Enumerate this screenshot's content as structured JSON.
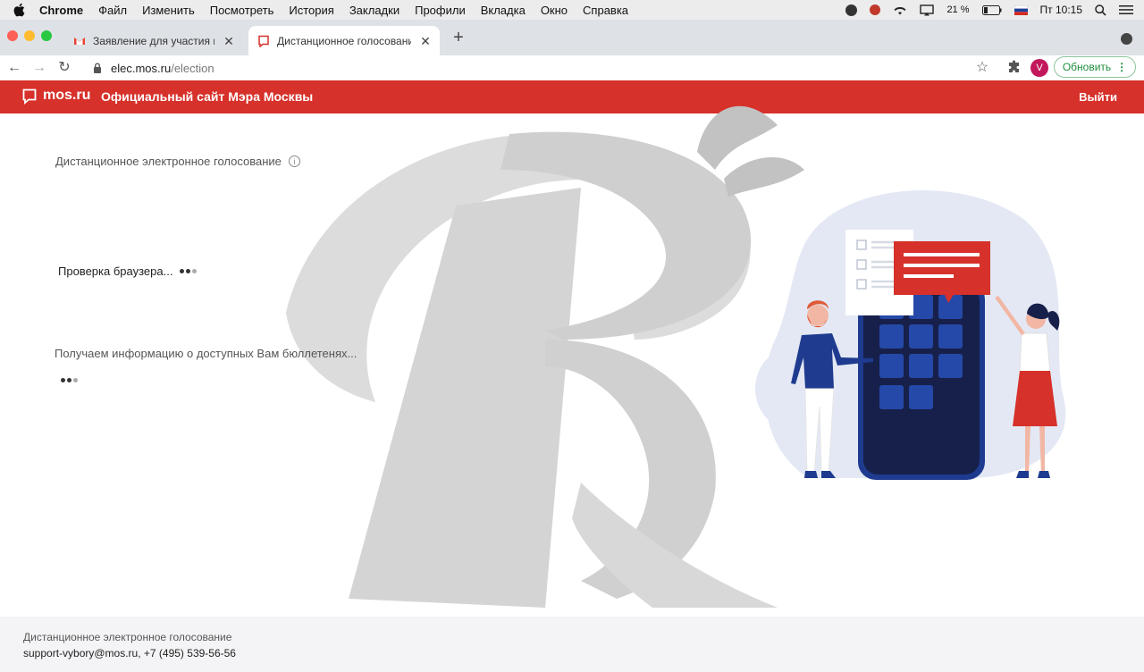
{
  "menubar": {
    "app": "Chrome",
    "items": [
      "Файл",
      "Изменить",
      "Посмотреть",
      "История",
      "Закладки",
      "Профили",
      "Вкладка",
      "Окно",
      "Справка"
    ],
    "battery": "21 %",
    "clock": "Пт 10:15"
  },
  "tabs": [
    {
      "title": "Заявление для участия в дис",
      "icon": "gmail-icon"
    },
    {
      "title": "Дистанционное голосование",
      "icon": "mos-icon"
    }
  ],
  "toolbar": {
    "url_host": "elec.mos.ru",
    "url_path": "/election",
    "profile_letter": "V",
    "update_label": "Обновить"
  },
  "site": {
    "logo": "mos.ru",
    "title": "Официальный сайт Мэра Москвы",
    "login": "Выйти",
    "brand_color": "#d6312a"
  },
  "main": {
    "heading": "Дистанционное электронное голосование",
    "status_browser": "Проверка браузера...",
    "status_ballots": "Получаем информацию о доступных Вам бюллетенях..."
  },
  "footer": {
    "title": "Дистанционное электронное голосование",
    "email": "support-vybory@mos.ru",
    "phone": ", +7 (495) 539-56-56"
  }
}
